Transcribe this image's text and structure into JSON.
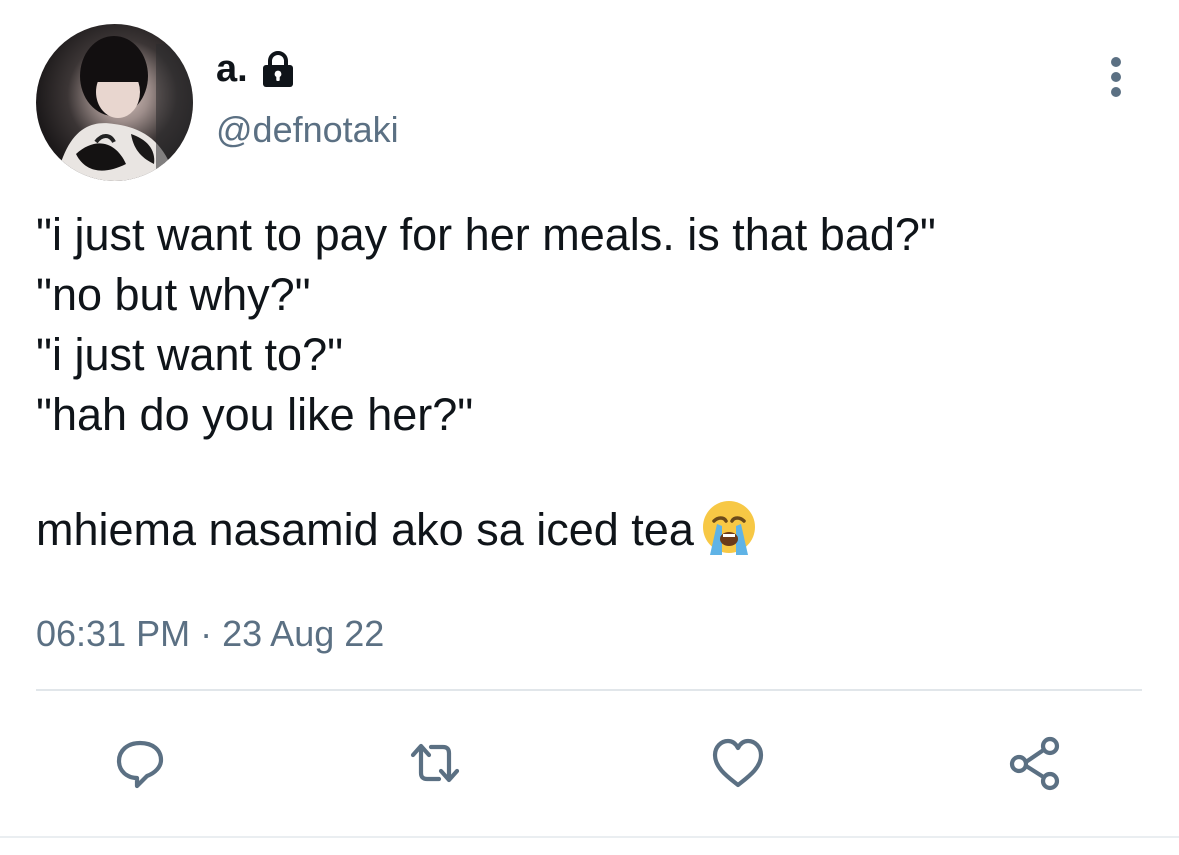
{
  "author": {
    "display_name": "a.",
    "handle": "@defnotaki",
    "protected": true,
    "avatar_icon": "profile-photo"
  },
  "tweet": {
    "lines": [
      "\"i just want to pay for her meals. is that bad?\"",
      "\"no but why?\"",
      "\"i just want to?\"",
      "\"hah do you like her?\""
    ],
    "closing_line": "mhiema nasamid ako sa iced tea",
    "emoji": "loudly-crying-face"
  },
  "meta": {
    "time": "06:31 PM",
    "separator": "·",
    "date": "23 Aug 22"
  },
  "actions": [
    {
      "name": "reply",
      "icon": "speech-bubble-icon"
    },
    {
      "name": "retweet",
      "icon": "retweet-arrows-icon"
    },
    {
      "name": "like",
      "icon": "heart-icon"
    },
    {
      "name": "share",
      "icon": "share-nodes-icon"
    }
  ],
  "colors": {
    "text_primary": "#0f1419",
    "text_secondary": "#5b7083",
    "divider": "#e1e6ea"
  }
}
